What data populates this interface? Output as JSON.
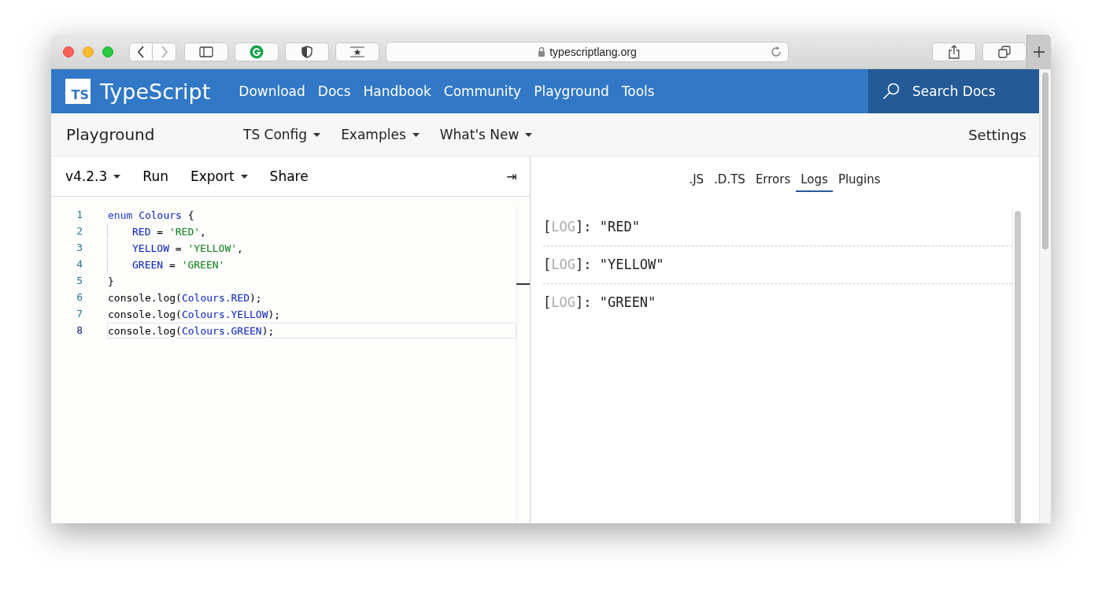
{
  "browser": {
    "url": "typescriptlang.org"
  },
  "site_nav": {
    "logo_badge": "TS",
    "logo_text": "TypeScript",
    "links": [
      "Download",
      "Docs",
      "Handbook",
      "Community",
      "Playground",
      "Tools"
    ],
    "search": "Search Docs"
  },
  "sub_nav": {
    "title": "Playground",
    "menus": [
      {
        "label": "TS Config",
        "dropdown": true
      },
      {
        "label": "Examples",
        "dropdown": true
      },
      {
        "label": "What's New",
        "dropdown": true
      }
    ],
    "settings": "Settings"
  },
  "editor_toolbar": [
    {
      "label": "v4.2.3",
      "dropdown": true
    },
    {
      "label": "Run",
      "dropdown": false
    },
    {
      "label": "Export",
      "dropdown": true
    },
    {
      "label": "Share",
      "dropdown": false
    }
  ],
  "collapse_glyph": "⇥",
  "code": [
    {
      "number": "1",
      "current": false,
      "indented": false,
      "tokens": [
        {
          "kind": "keyword",
          "text": "enum "
        },
        {
          "kind": "ident",
          "text": "Colours"
        },
        {
          "kind": "plain",
          "text": " {"
        }
      ]
    },
    {
      "number": "2",
      "current": false,
      "indented": true,
      "tokens": [
        {
          "kind": "ident",
          "text": "RED"
        },
        {
          "kind": "plain",
          "text": " = "
        },
        {
          "kind": "string",
          "text": "'RED'"
        },
        {
          "kind": "plain",
          "text": ","
        }
      ]
    },
    {
      "number": "3",
      "current": false,
      "indented": true,
      "tokens": [
        {
          "kind": "ident",
          "text": "YELLOW"
        },
        {
          "kind": "plain",
          "text": " = "
        },
        {
          "kind": "string",
          "text": "'YELLOW'"
        },
        {
          "kind": "plain",
          "text": ","
        }
      ]
    },
    {
      "number": "4",
      "current": false,
      "indented": true,
      "tokens": [
        {
          "kind": "ident",
          "text": "GREEN"
        },
        {
          "kind": "plain",
          "text": " = "
        },
        {
          "kind": "string",
          "text": "'GREEN'"
        }
      ]
    },
    {
      "number": "5",
      "current": false,
      "indented": false,
      "tokens": [
        {
          "kind": "plain",
          "text": "}"
        }
      ]
    },
    {
      "number": "6",
      "current": false,
      "indented": false,
      "tokens": [
        {
          "kind": "plain",
          "text": "console.log("
        },
        {
          "kind": "ident",
          "text": "Colours.RED"
        },
        {
          "kind": "plain",
          "text": ");"
        }
      ]
    },
    {
      "number": "7",
      "current": false,
      "indented": false,
      "tokens": [
        {
          "kind": "plain",
          "text": "console.log("
        },
        {
          "kind": "ident",
          "text": "Colours.YELLOW"
        },
        {
          "kind": "plain",
          "text": ");"
        }
      ]
    },
    {
      "number": "8",
      "current": true,
      "indented": false,
      "tokens": [
        {
          "kind": "plain",
          "text": "console.log("
        },
        {
          "kind": "ident",
          "text": "Colours.GREEN"
        },
        {
          "kind": "plain",
          "text": ");"
        }
      ]
    }
  ],
  "output_tabs": [
    {
      "label": ".JS",
      "selected": false
    },
    {
      "label": ".D.TS",
      "selected": false
    },
    {
      "label": "Errors",
      "selected": false
    },
    {
      "label": "Logs",
      "selected": true
    },
    {
      "label": "Plugins",
      "selected": false
    }
  ],
  "logs": [
    {
      "open": "[",
      "level": "LOG",
      "close": "]:",
      "message": "\"RED\""
    },
    {
      "open": "[",
      "level": "LOG",
      "close": "]:",
      "message": "\"YELLOW\""
    },
    {
      "open": "[",
      "level": "LOG",
      "close": "]:",
      "message": "\"GREEN\""
    }
  ]
}
